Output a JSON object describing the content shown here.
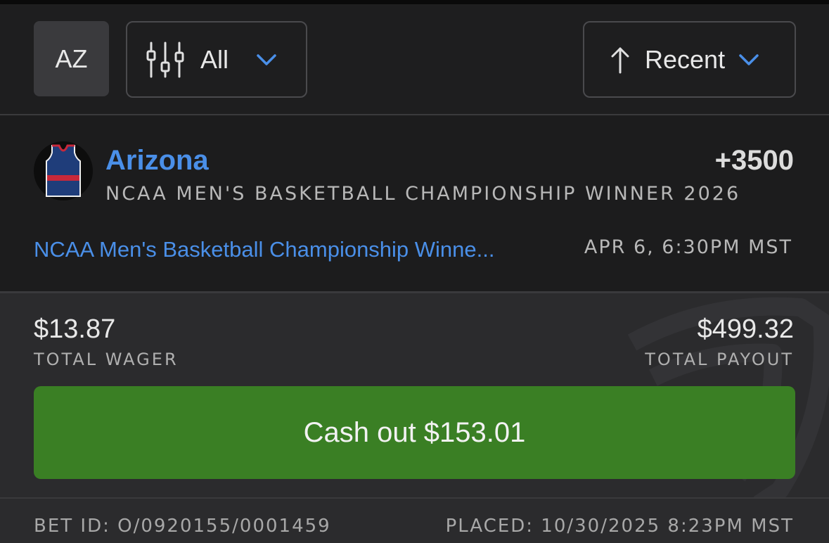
{
  "filters": {
    "state_label": "AZ",
    "filter_label": "All",
    "sort_label": "Recent"
  },
  "bet": {
    "team": "Arizona",
    "odds": "+3500",
    "market": "NCAA MEN'S BASKETBALL CHAMPIONSHIP WINNER 2026",
    "event_link": "NCAA Men's Basketball Championship Winne...",
    "event_time": "APR 6, 6:30PM MST"
  },
  "summary": {
    "wager_amount": "$13.87",
    "wager_label": "TOTAL WAGER",
    "payout_amount": "$499.32",
    "payout_label": "TOTAL PAYOUT",
    "cashout_label": "Cash out $153.01"
  },
  "footer": {
    "bet_id": "BET ID: O/0920155/0001459",
    "placed": "PLACED: 10/30/2025 8:23PM MST"
  },
  "colors": {
    "accent_blue": "#4a8fe8",
    "cashout_green": "#3a7f24",
    "jersey_navy": "#1f3d7a",
    "jersey_red": "#c8283a"
  },
  "icons": [
    "sliders-icon",
    "chevron-down-icon",
    "arrow-up-icon",
    "jersey-icon",
    "shield-watermark-icon"
  ]
}
